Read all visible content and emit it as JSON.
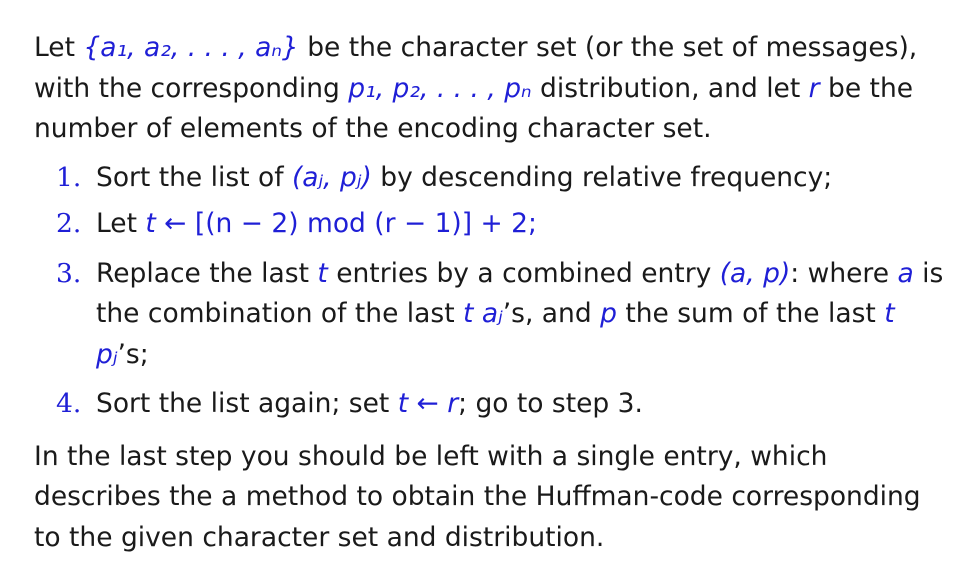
{
  "intro": {
    "t1": "Let ",
    "set_expr": "{a₁, a₂, . . . , aₙ}",
    "t2": " be the character set (or the set of messages), with the corresponding ",
    "prob_expr": "p₁, p₂, . . . , pₙ",
    "t3": " distribution, and let ",
    "r_var": "r",
    "t4": " be the number of elements of the encoding character set."
  },
  "steps": [
    {
      "num": "1.",
      "t1": "Sort the list of ",
      "expr": "(aⱼ, pⱼ)",
      "t2": " by descending relative frequency;"
    },
    {
      "num": "2.",
      "t1": "Let ",
      "t_var": "t",
      "expr": " ← [(n − 2) mod (r − 1)] + 2;"
    },
    {
      "num": "3.",
      "t1": "Replace the last ",
      "t_var": "t",
      "t2": " entries by a combined entry ",
      "ap_expr": "(a, p)",
      "t3": ": where ",
      "a_var": "a",
      "t4": " is the combination of the last ",
      "t_var2": "t",
      "t5": " ",
      "aj_expr": "aⱼ",
      "t6": "’s, and ",
      "p_var": "p",
      "t7": " the sum of the last ",
      "t_var3": "t",
      "t8": " ",
      "pj_expr": "pⱼ",
      "t9": "’s;"
    },
    {
      "num": "4.",
      "t1": "Sort the list again; set ",
      "t_var": "t",
      "expr": " ← r",
      "t2": "; go to step 3."
    }
  ],
  "closing": "In the last step you should be left with a single entry, which describes the a method to obtain the Huffman-code corresponding to the given character set and distribution.",
  "colors": {
    "text": "#1a1a1a",
    "accent": "#1f1fd6",
    "background": "#ffffff"
  }
}
